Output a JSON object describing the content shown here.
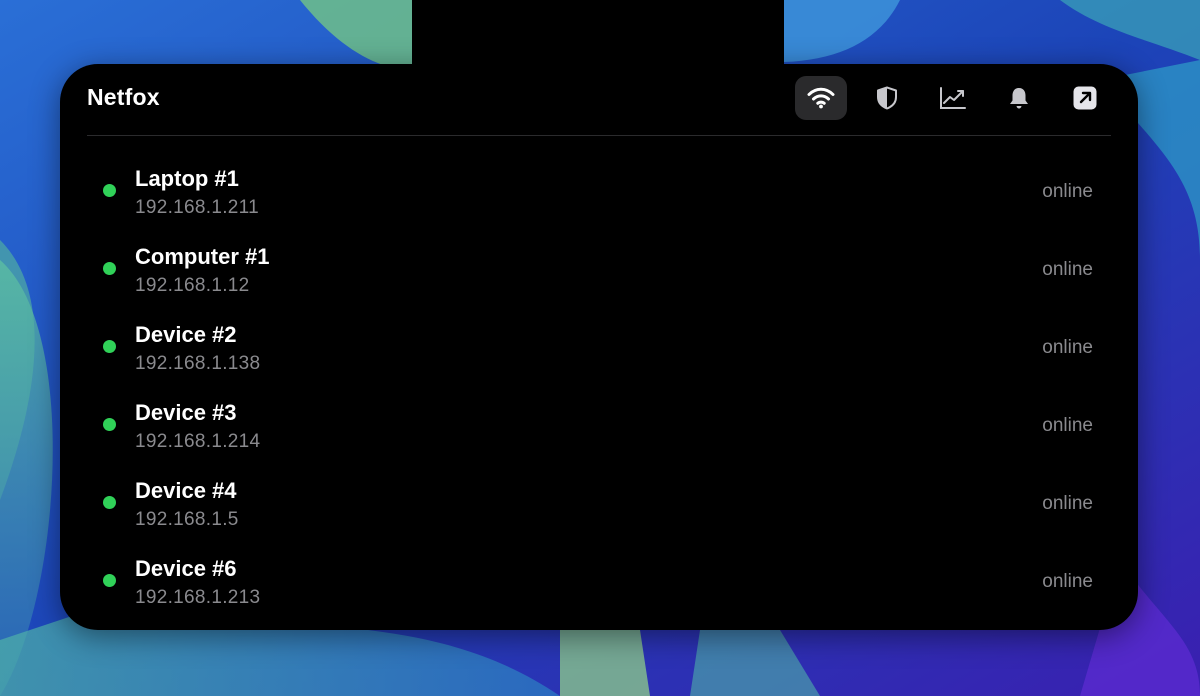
{
  "app": {
    "title": "Netfox"
  },
  "toolbar": {
    "buttons": [
      {
        "icon": "wifi-icon",
        "active": true
      },
      {
        "icon": "shield-icon",
        "active": false
      },
      {
        "icon": "chart-icon",
        "active": false
      },
      {
        "icon": "bell-icon",
        "active": false
      },
      {
        "icon": "open-external-icon",
        "active": false
      }
    ]
  },
  "devices": [
    {
      "name": "Laptop #1",
      "ip": "192.168.1.211",
      "status": "online"
    },
    {
      "name": "Computer #1",
      "ip": "192.168.1.12",
      "status": "online"
    },
    {
      "name": "Device #2",
      "ip": "192.168.1.138",
      "status": "online"
    },
    {
      "name": "Device #3",
      "ip": "192.168.1.214",
      "status": "online"
    },
    {
      "name": "Device #4",
      "ip": "192.168.1.5",
      "status": "online"
    },
    {
      "name": "Device #6",
      "ip": "192.168.1.213",
      "status": "online"
    }
  ],
  "colors": {
    "online": "#30d158",
    "panel": "#000000",
    "secondary_text": "#8a8a8e"
  }
}
